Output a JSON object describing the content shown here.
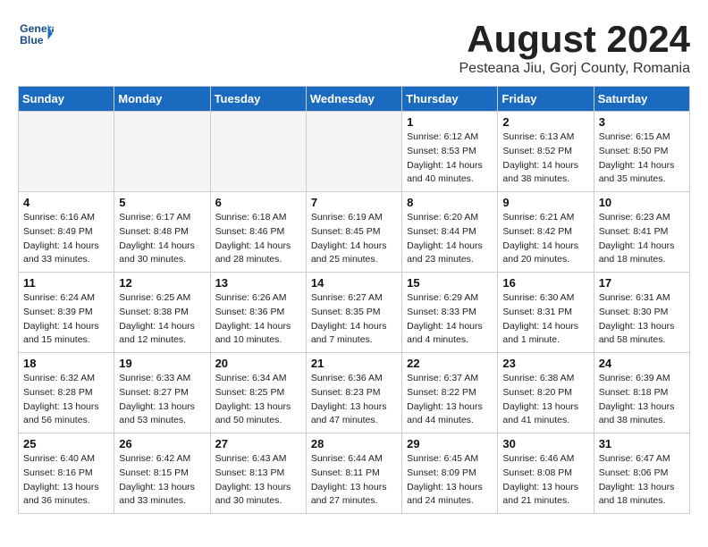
{
  "header": {
    "logo_line1": "General",
    "logo_line2": "Blue",
    "month_title": "August 2024",
    "location": "Pesteana Jiu, Gorj County, Romania"
  },
  "days_of_week": [
    "Sunday",
    "Monday",
    "Tuesday",
    "Wednesday",
    "Thursday",
    "Friday",
    "Saturday"
  ],
  "weeks": [
    [
      {
        "num": "",
        "info": ""
      },
      {
        "num": "",
        "info": ""
      },
      {
        "num": "",
        "info": ""
      },
      {
        "num": "",
        "info": ""
      },
      {
        "num": "1",
        "info": "Sunrise: 6:12 AM\nSunset: 8:53 PM\nDaylight: 14 hours\nand 40 minutes."
      },
      {
        "num": "2",
        "info": "Sunrise: 6:13 AM\nSunset: 8:52 PM\nDaylight: 14 hours\nand 38 minutes."
      },
      {
        "num": "3",
        "info": "Sunrise: 6:15 AM\nSunset: 8:50 PM\nDaylight: 14 hours\nand 35 minutes."
      }
    ],
    [
      {
        "num": "4",
        "info": "Sunrise: 6:16 AM\nSunset: 8:49 PM\nDaylight: 14 hours\nand 33 minutes."
      },
      {
        "num": "5",
        "info": "Sunrise: 6:17 AM\nSunset: 8:48 PM\nDaylight: 14 hours\nand 30 minutes."
      },
      {
        "num": "6",
        "info": "Sunrise: 6:18 AM\nSunset: 8:46 PM\nDaylight: 14 hours\nand 28 minutes."
      },
      {
        "num": "7",
        "info": "Sunrise: 6:19 AM\nSunset: 8:45 PM\nDaylight: 14 hours\nand 25 minutes."
      },
      {
        "num": "8",
        "info": "Sunrise: 6:20 AM\nSunset: 8:44 PM\nDaylight: 14 hours\nand 23 minutes."
      },
      {
        "num": "9",
        "info": "Sunrise: 6:21 AM\nSunset: 8:42 PM\nDaylight: 14 hours\nand 20 minutes."
      },
      {
        "num": "10",
        "info": "Sunrise: 6:23 AM\nSunset: 8:41 PM\nDaylight: 14 hours\nand 18 minutes."
      }
    ],
    [
      {
        "num": "11",
        "info": "Sunrise: 6:24 AM\nSunset: 8:39 PM\nDaylight: 14 hours\nand 15 minutes."
      },
      {
        "num": "12",
        "info": "Sunrise: 6:25 AM\nSunset: 8:38 PM\nDaylight: 14 hours\nand 12 minutes."
      },
      {
        "num": "13",
        "info": "Sunrise: 6:26 AM\nSunset: 8:36 PM\nDaylight: 14 hours\nand 10 minutes."
      },
      {
        "num": "14",
        "info": "Sunrise: 6:27 AM\nSunset: 8:35 PM\nDaylight: 14 hours\nand 7 minutes."
      },
      {
        "num": "15",
        "info": "Sunrise: 6:29 AM\nSunset: 8:33 PM\nDaylight: 14 hours\nand 4 minutes."
      },
      {
        "num": "16",
        "info": "Sunrise: 6:30 AM\nSunset: 8:31 PM\nDaylight: 14 hours\nand 1 minute."
      },
      {
        "num": "17",
        "info": "Sunrise: 6:31 AM\nSunset: 8:30 PM\nDaylight: 13 hours\nand 58 minutes."
      }
    ],
    [
      {
        "num": "18",
        "info": "Sunrise: 6:32 AM\nSunset: 8:28 PM\nDaylight: 13 hours\nand 56 minutes."
      },
      {
        "num": "19",
        "info": "Sunrise: 6:33 AM\nSunset: 8:27 PM\nDaylight: 13 hours\nand 53 minutes."
      },
      {
        "num": "20",
        "info": "Sunrise: 6:34 AM\nSunset: 8:25 PM\nDaylight: 13 hours\nand 50 minutes."
      },
      {
        "num": "21",
        "info": "Sunrise: 6:36 AM\nSunset: 8:23 PM\nDaylight: 13 hours\nand 47 minutes."
      },
      {
        "num": "22",
        "info": "Sunrise: 6:37 AM\nSunset: 8:22 PM\nDaylight: 13 hours\nand 44 minutes."
      },
      {
        "num": "23",
        "info": "Sunrise: 6:38 AM\nSunset: 8:20 PM\nDaylight: 13 hours\nand 41 minutes."
      },
      {
        "num": "24",
        "info": "Sunrise: 6:39 AM\nSunset: 8:18 PM\nDaylight: 13 hours\nand 38 minutes."
      }
    ],
    [
      {
        "num": "25",
        "info": "Sunrise: 6:40 AM\nSunset: 8:16 PM\nDaylight: 13 hours\nand 36 minutes."
      },
      {
        "num": "26",
        "info": "Sunrise: 6:42 AM\nSunset: 8:15 PM\nDaylight: 13 hours\nand 33 minutes."
      },
      {
        "num": "27",
        "info": "Sunrise: 6:43 AM\nSunset: 8:13 PM\nDaylight: 13 hours\nand 30 minutes."
      },
      {
        "num": "28",
        "info": "Sunrise: 6:44 AM\nSunset: 8:11 PM\nDaylight: 13 hours\nand 27 minutes."
      },
      {
        "num": "29",
        "info": "Sunrise: 6:45 AM\nSunset: 8:09 PM\nDaylight: 13 hours\nand 24 minutes."
      },
      {
        "num": "30",
        "info": "Sunrise: 6:46 AM\nSunset: 8:08 PM\nDaylight: 13 hours\nand 21 minutes."
      },
      {
        "num": "31",
        "info": "Sunrise: 6:47 AM\nSunset: 8:06 PM\nDaylight: 13 hours\nand 18 minutes."
      }
    ]
  ]
}
